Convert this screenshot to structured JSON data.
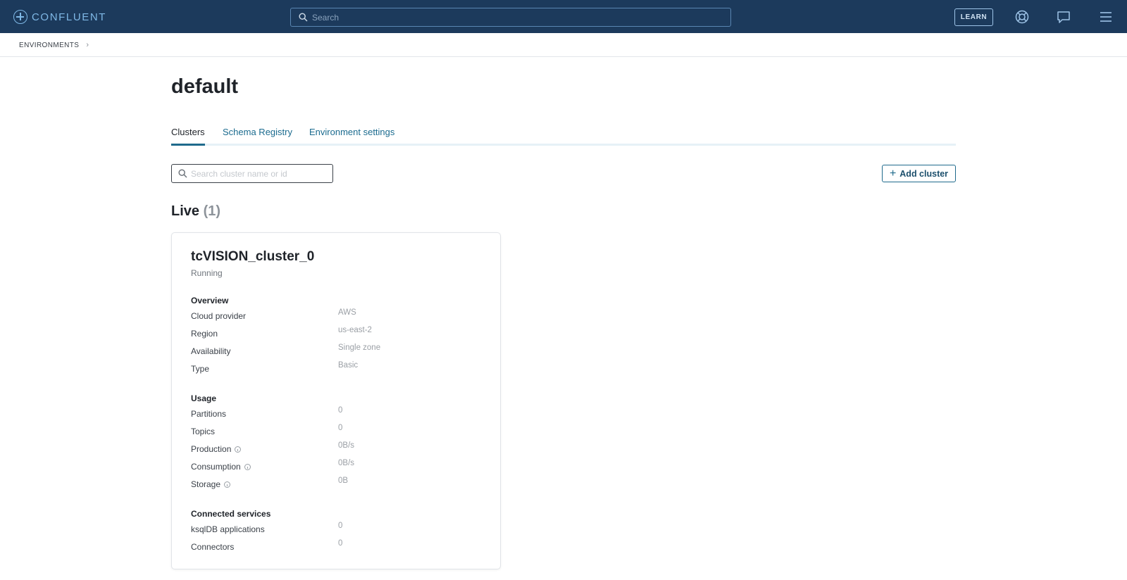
{
  "app": {
    "logo_text": "CONFLUENT",
    "search_placeholder": "Search",
    "learn_label": "LEARN",
    "icons": [
      "help-icon",
      "chat-icon",
      "menu-icon"
    ],
    "colors": {
      "topbar": "#1c3a5c",
      "accent": "#1f6a8c",
      "logo": "#7fb8e6"
    }
  },
  "breadcrumb": {
    "items": [
      "ENVIRONMENTS"
    ],
    "separator": "›"
  },
  "page": {
    "title": "default",
    "tabs": [
      {
        "label": "Clusters",
        "active": true
      },
      {
        "label": "Schema Registry",
        "active": false
      },
      {
        "label": "Environment settings",
        "active": false
      }
    ],
    "cluster_search_placeholder": "Search cluster name or id",
    "add_cluster_label": "Add cluster",
    "live_label": "Live",
    "live_count": "(1)"
  },
  "cluster": {
    "name": "tcVISION_cluster_0",
    "status": "Running",
    "overview": {
      "title": "Overview",
      "rows": [
        {
          "label": "Cloud provider",
          "value": "AWS"
        },
        {
          "label": "Region",
          "value": "us-east-2"
        },
        {
          "label": "Availability",
          "value": "Single zone"
        },
        {
          "label": "Type",
          "value": "Basic"
        }
      ]
    },
    "usage": {
      "title": "Usage",
      "rows": [
        {
          "label": "Partitions",
          "value": "0"
        },
        {
          "label": "Topics",
          "value": "0"
        },
        {
          "label": "Production",
          "value": "0B/s",
          "info": true
        },
        {
          "label": "Consumption",
          "value": "0B/s",
          "info": true
        },
        {
          "label": "Storage",
          "value": "0B",
          "info": true
        }
      ]
    },
    "connected_services": {
      "title": "Connected services",
      "rows": [
        {
          "label": "ksqlDB applications",
          "value": "0"
        },
        {
          "label": "Connectors",
          "value": "0"
        }
      ]
    }
  }
}
